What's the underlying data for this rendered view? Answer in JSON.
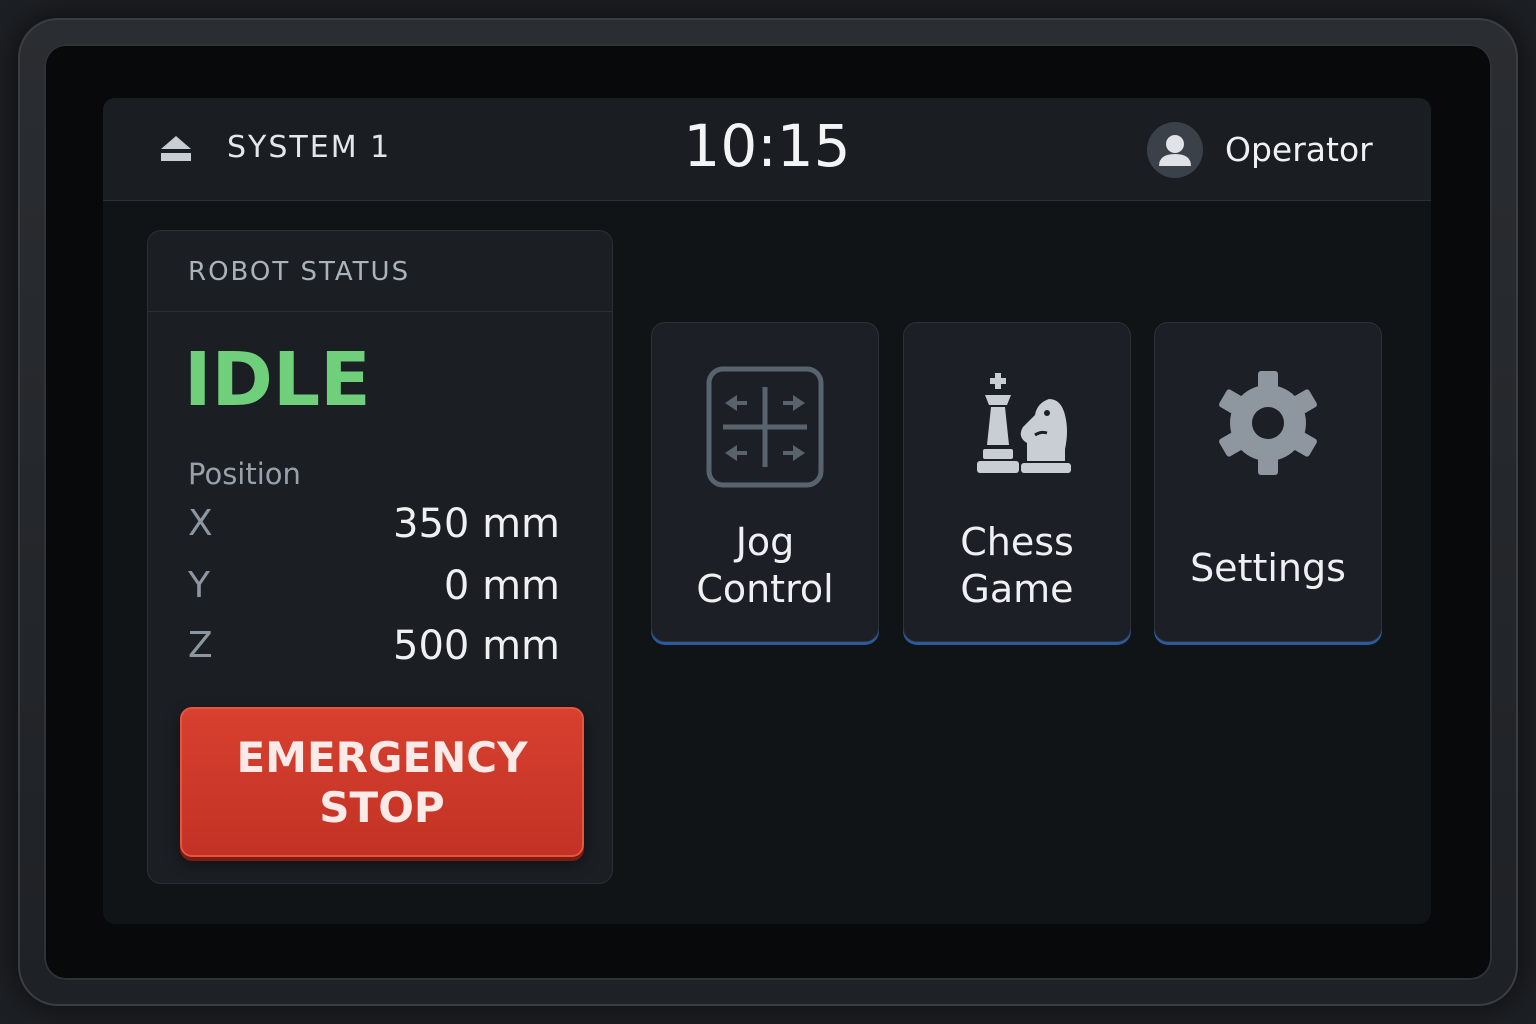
{
  "header": {
    "system_name": "SYSTEM 1",
    "time": "10:15",
    "user": "Operator",
    "system_icon": "eject-icon",
    "user_icon": "user-avatar-icon"
  },
  "status": {
    "title": "ROBOT STATUS",
    "state": "IDLE",
    "state_color": "#6fcf7a",
    "position_label": "Position",
    "axes": [
      {
        "name": "X",
        "value": "350 mm"
      },
      {
        "name": "Y",
        "value": "0 mm"
      },
      {
        "name": "Z",
        "value": "500 mm"
      }
    ],
    "emergency_label": "EMERGENCY\nSTOP",
    "emergency_color": "#c9382a"
  },
  "tiles": [
    {
      "label": "Jog\nControl",
      "icon": "jog-arrows-icon"
    },
    {
      "label": "Chess\nGame",
      "icon": "chess-pieces-icon"
    },
    {
      "label": "Settings",
      "icon": "gear-icon"
    }
  ],
  "colors": {
    "accent": "#2a5aa0",
    "background": "#111417"
  }
}
